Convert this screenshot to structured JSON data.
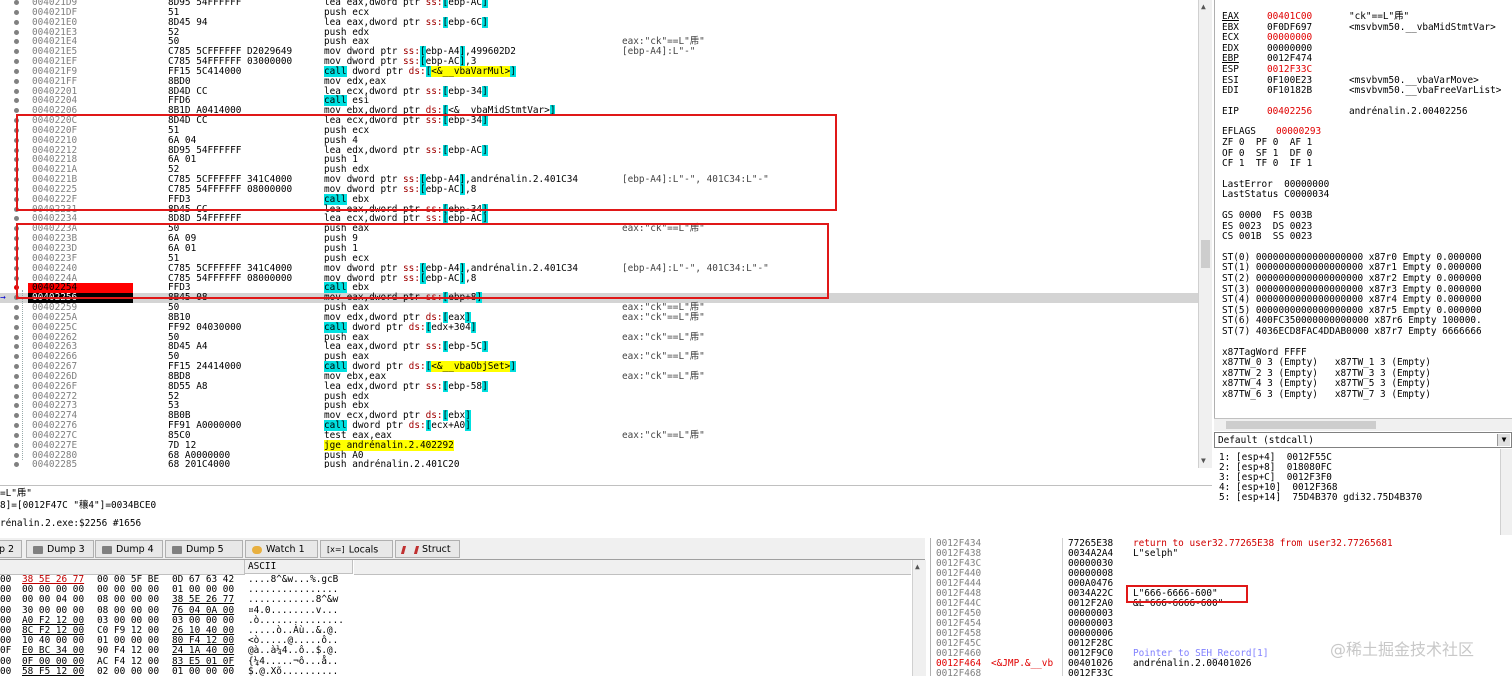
{
  "disasm": {
    "rows": [
      {
        "addr": "004021D9",
        "hex": "8D95 54FFFFFF",
        "asm": "lea eax,dword ptr ss:[ebp-AC]",
        "cmt": ""
      },
      {
        "addr": "004021DF",
        "hex": "51",
        "asm": "push ecx",
        "cmt": ""
      },
      {
        "addr": "004021E0",
        "hex": "8D45 94",
        "asm": "lea eax,dword ptr ss:[ebp-6C]",
        "cmt": ""
      },
      {
        "addr": "004021E3",
        "hex": "52",
        "asm": "push edx",
        "cmt": ""
      },
      {
        "addr": "004021E4",
        "hex": "50",
        "asm": "push eax",
        "cmt": "eax:\"ck\"==L\"乕\""
      },
      {
        "addr": "004021E5",
        "hex": "C785 5CFFFFFF D2029649",
        "asm": "mov dword ptr ss:[ebp-A4],499602D2",
        "cmt": "[ebp-A4]:L\"-\""
      },
      {
        "addr": "004021EF",
        "hex": "C785 54FFFFFF 03000000",
        "asm": "mov dword ptr ss:[ebp-AC],3",
        "cmt": ""
      },
      {
        "addr": "004021F9",
        "hex": "FF15 5C414000",
        "asm": "call dword ptr ds:[<&__vbaVarMul>]",
        "cmt": "",
        "call": true,
        "label": "<&__vbaVarMul>"
      },
      {
        "addr": "004021FF",
        "hex": "8BD0",
        "asm": "mov edx,eax",
        "cmt": ""
      },
      {
        "addr": "00402201",
        "hex": "8D4D CC",
        "asm": "lea ecx,dword ptr ss:[ebp-34]",
        "cmt": ""
      },
      {
        "addr": "00402204",
        "hex": "FFD6",
        "asm": "call esi",
        "cmt": "",
        "call": true
      },
      {
        "addr": "00402206",
        "hex": "8B1D A0414000",
        "asm": "mov ebx,dword ptr ds:[<&__vbaMidStmtVar>]",
        "cmt": ""
      },
      {
        "addr": "0040220C",
        "hex": "8D4D CC",
        "asm": "lea ecx,dword ptr ss:[ebp-34]",
        "cmt": ""
      },
      {
        "addr": "0040220F",
        "hex": "51",
        "asm": "push ecx",
        "cmt": ""
      },
      {
        "addr": "00402210",
        "hex": "6A 04",
        "asm": "push 4",
        "cmt": ""
      },
      {
        "addr": "00402212",
        "hex": "8D95 54FFFFFF",
        "asm": "lea edx,dword ptr ss:[ebp-AC]",
        "cmt": ""
      },
      {
        "addr": "00402218",
        "hex": "6A 01",
        "asm": "push 1",
        "cmt": ""
      },
      {
        "addr": "0040221A",
        "hex": "52",
        "asm": "push edx",
        "cmt": ""
      },
      {
        "addr": "0040221B",
        "hex": "C785 5CFFFFFF 341C4000",
        "asm": "mov dword ptr ss:[ebp-A4],andrénalin.2.401C34",
        "cmt": "[ebp-A4]:L\"-\", 401C34:L\"-\""
      },
      {
        "addr": "00402225",
        "hex": "C785 54FFFFFF 08000000",
        "asm": "mov dword ptr ss:[ebp-AC],8",
        "cmt": ""
      },
      {
        "addr": "0040222F",
        "hex": "FFD3",
        "asm": "call ebx",
        "cmt": "",
        "call": true
      },
      {
        "addr": "00402231",
        "hex": "8D45 CC",
        "asm": "lea eax,dword ptr ss:[ebp-34]",
        "cmt": ""
      },
      {
        "addr": "00402234",
        "hex": "8D8D 54FFFFFF",
        "asm": "lea ecx,dword ptr ss:[ebp-AC]",
        "cmt": ""
      },
      {
        "addr": "0040223A",
        "hex": "50",
        "asm": "push eax",
        "cmt": "eax:\"ck\"==L\"乕\""
      },
      {
        "addr": "0040223B",
        "hex": "6A 09",
        "asm": "push 9",
        "cmt": ""
      },
      {
        "addr": "0040223D",
        "hex": "6A 01",
        "asm": "push 1",
        "cmt": ""
      },
      {
        "addr": "0040223F",
        "hex": "51",
        "asm": "push ecx",
        "cmt": ""
      },
      {
        "addr": "00402240",
        "hex": "C785 5CFFFFFF 341C4000",
        "asm": "mov dword ptr ss:[ebp-A4],andrénalin.2.401C34",
        "cmt": "[ebp-A4]:L\"-\", 401C34:L\"-\""
      },
      {
        "addr": "0040224A",
        "hex": "C785 54FFFFFF 08000000",
        "asm": "mov dword ptr ss:[ebp-AC],8",
        "cmt": ""
      },
      {
        "addr": "00402254",
        "hex": "FFD3",
        "asm": "call ebx",
        "cmt": "",
        "call": true,
        "bp": true
      },
      {
        "addr": "00402256",
        "hex": "8B45 08",
        "asm": "mov eax,dword ptr ss:[ebp+8]",
        "cmt": "",
        "eip": true
      },
      {
        "addr": "00402259",
        "hex": "50",
        "asm": "push eax",
        "cmt": "eax:\"ck\"==L\"乕\""
      },
      {
        "addr": "0040225A",
        "hex": "8B10",
        "asm": "mov edx,dword ptr ds:[eax]",
        "cmt": "eax:\"ck\"==L\"乕\""
      },
      {
        "addr": "0040225C",
        "hex": "FF92 04030000",
        "asm": "call dword ptr ds:[edx+304]",
        "cmt": "",
        "call": true
      },
      {
        "addr": "00402262",
        "hex": "50",
        "asm": "push eax",
        "cmt": "eax:\"ck\"==L\"乕\""
      },
      {
        "addr": "00402263",
        "hex": "8D45 A4",
        "asm": "lea eax,dword ptr ss:[ebp-5C]",
        "cmt": ""
      },
      {
        "addr": "00402266",
        "hex": "50",
        "asm": "push eax",
        "cmt": "eax:\"ck\"==L\"乕\""
      },
      {
        "addr": "00402267",
        "hex": "FF15 24414000",
        "asm": "call dword ptr ds:[<&__vbaObjSet>]",
        "cmt": "",
        "call": true,
        "label": "<&__vbaObjSet>"
      },
      {
        "addr": "0040226D",
        "hex": "8BD8",
        "asm": "mov ebx,eax",
        "cmt": "eax:\"ck\"==L\"乕\""
      },
      {
        "addr": "0040226F",
        "hex": "8D55 A8",
        "asm": "lea edx,dword ptr ss:[ebp-58]",
        "cmt": ""
      },
      {
        "addr": "00402272",
        "hex": "52",
        "asm": "push edx",
        "cmt": ""
      },
      {
        "addr": "00402273",
        "hex": "53",
        "asm": "push ebx",
        "cmt": ""
      },
      {
        "addr": "00402274",
        "hex": "8B0B",
        "asm": "mov ecx,dword ptr ds:[ebx]",
        "cmt": ""
      },
      {
        "addr": "00402276",
        "hex": "FF91 A0000000",
        "asm": "call dword ptr ds:[ecx+A0]",
        "cmt": "",
        "call": true
      },
      {
        "addr": "0040227C",
        "hex": "85C0",
        "asm": "test eax,eax",
        "cmt": "eax:\"ck\"==L\"乕\""
      },
      {
        "addr": "0040227E",
        "hex": "7D 12",
        "asm": "jge andrénalin.2.402292",
        "cmt": "",
        "jmp": true
      },
      {
        "addr": "00402280",
        "hex": "68 A0000000",
        "asm": "push A0",
        "cmt": ""
      },
      {
        "addr": "00402285",
        "hex": "68 201C4000",
        "asm": "push andrénalin.2.401C20",
        "cmt": ""
      }
    ]
  },
  "registers": {
    "gp": [
      {
        "name": "EAX",
        "value": "00401C00",
        "cmt": "\"ck\"==L\"乕\"",
        "changed": true
      },
      {
        "name": "EBX",
        "value": "0F0DF697",
        "cmt": "<msvbvm50.__vbaMidStmtVar>"
      },
      {
        "name": "ECX",
        "value": "00000000",
        "cmt": "",
        "changed": true
      },
      {
        "name": "EDX",
        "value": "00000000",
        "cmt": ""
      },
      {
        "name": "EBP",
        "value": "0012F474",
        "cmt": ""
      },
      {
        "name": "ESP",
        "value": "0012F33C",
        "cmt": "",
        "changed": true
      },
      {
        "name": "ESI",
        "value": "0F100E23",
        "cmt": "<msvbvm50.__vbaVarMove>"
      },
      {
        "name": "EDI",
        "value": "0F10182B",
        "cmt": "<msvbvm50.__vbaFreeVarList>"
      }
    ],
    "eip": {
      "name": "EIP",
      "value": "00402256",
      "cmt": "andrénalin.2.00402256"
    },
    "eflags": {
      "name": "EFLAGS",
      "value": "00000293"
    },
    "flags": [
      "ZF 0  PF 0  AF 1",
      "OF 0  SF 1  DF 0",
      "CF 1  TF 0  IF 1"
    ],
    "last": [
      "LastError  00000000",
      "LastStatus C0000034"
    ],
    "segs": [
      "GS 0000  FS 003B",
      "ES 0023  DS 0023",
      "CS 001B  SS 0023"
    ],
    "st": [
      "ST(0) 0000000000000000000 x87r0 Empty 0.000000",
      "ST(1) 0000000000000000000 x87r1 Empty 0.000000",
      "ST(2) 0000000000000000000 x87r2 Empty 0.000000",
      "ST(3) 0000000000000000000 x87r3 Empty 0.000000",
      "ST(4) 0000000000000000000 x87r4 Empty 0.000000",
      "ST(5) 0000000000000000000 x87r5 Empty 0.000000",
      "ST(6) 400FC350000000000000 x87r6 Empty 100000.",
      "ST(7) 4036ECD8FAC4DDAB0000 x87r7 Empty 6666666"
    ],
    "tag": [
      "x87TagWord FFFF",
      "x87TW_0 3 (Empty)   x87TW_1 3 (Empty)",
      "x87TW_2 3 (Empty)   x87TW_3 3 (Empty)",
      "x87TW_4 3 (Empty)   x87TW_5 3 (Empty)",
      "x87TW_6 3 (Empty)   x87TW_7 3 (Empty)"
    ]
  },
  "callconv": {
    "value": "Default (stdcall)"
  },
  "stackargs": [
    "1: [esp+4]  0012F55C",
    "2: [esp+8]  018080FC",
    "3: [esp+C]  0012F3F0",
    "4: [esp+10]  0012F368",
    "5: [esp+14]  75D4B370 gdi32.75D4B370"
  ],
  "info": {
    "line1": "=L\"乕\"",
    "line2": "8]=[0012F47C \"穰4\"]=0034BCE0",
    "line3": "rénalin.2.exe:$2256 #1656"
  },
  "tabs": [
    {
      "label": "p 2"
    },
    {
      "label": "Dump 3"
    },
    {
      "label": "Dump 4"
    },
    {
      "label": "Dump 5"
    },
    {
      "label": "Watch 1"
    },
    {
      "label": "Locals",
      "prefix": "[x=]"
    },
    {
      "label": "Struct"
    }
  ],
  "dump": {
    "ascii_header": "ASCII",
    "rows": [
      {
        "a": "00",
        "b": "38 5E 26 77",
        "c": "00 00 5F BE",
        "d": "0D 67 63 42",
        "asc": "....8^&w...%.gcB"
      },
      {
        "a": "00",
        "b": "00 00 00 00",
        "c": "00 00 00 00",
        "d": "01 00 00 00",
        "asc": "................"
      },
      {
        "a": "00",
        "b": "00 00 04 00",
        "c": "08 00 00 00",
        "d": "38 5E 26 77",
        "asc": "............8^&w"
      },
      {
        "a": "00",
        "b": "30 00 00 00",
        "c": "08 00 00 00",
        "d": "76 04 0A 00",
        "asc": "¤4.0........v..."
      },
      {
        "a": "00",
        "b": "A0 F2 12 00",
        "c": "03 00 00 00",
        "d": "03 00 00 00",
        "asc": ".ò..............."
      },
      {
        "a": "00",
        "b": "8C F2 12 00",
        "c": "C0 F9 12 00",
        "d": "26 10 40 00",
        "asc": ".....ò..Àù..&.@."
      },
      {
        "a": "00",
        "b": "10 40 00 00",
        "c": "01 00 00 00",
        "d": "80 F4 12 00",
        "asc": "<ò.....@.....ô.."
      },
      {
        "a": "0F",
        "b": "E0 BC 34 00",
        "c": "90 F4 12 00",
        "d": "24 1A 40 00",
        "asc": "@à..à¼4..ô..$.@."
      },
      {
        "a": "00",
        "b": "0F 00 00 00",
        "c": "AC F4 12 00",
        "d": "83 E5 01 0F",
        "asc": "{¼4.....¬ô...å.."
      },
      {
        "a": "00",
        "b": "58 F5 12 00",
        "c": "02 00 00 00",
        "d": "01 00 00 00",
        "asc": "$.@.Xõ.........."
      }
    ]
  },
  "stack": {
    "rows": [
      {
        "addr": "0012F434",
        "val": "77265E38",
        "cmt": "return to user32.77265E38 from user32.77265681",
        "red": true
      },
      {
        "addr": "0012F438",
        "val": "0034A2A4",
        "cmt": "L\"selph\""
      },
      {
        "addr": "0012F43C",
        "val": "00000030",
        "cmt": ""
      },
      {
        "addr": "0012F440",
        "val": "00000008",
        "cmt": ""
      },
      {
        "addr": "0012F444",
        "val": "000A0476",
        "cmt": ""
      },
      {
        "addr": "0012F448",
        "val": "0034A22C",
        "cmt": "L\"666-6666-600\""
      },
      {
        "addr": "0012F44C",
        "val": "0012F2A0",
        "cmt": "&L\"666-6666-600\""
      },
      {
        "addr": "0012F450",
        "val": "00000003",
        "cmt": ""
      },
      {
        "addr": "0012F454",
        "val": "00000003",
        "cmt": ""
      },
      {
        "addr": "0012F458",
        "val": "00000006",
        "cmt": ""
      },
      {
        "addr": "0012F45C",
        "val": "0012F28C",
        "cmt": ""
      },
      {
        "addr": "0012F460",
        "val": "0012F9C0",
        "cmt": "Pointer to SEH_Record[1]",
        "blue": true
      },
      {
        "addr": "0012F464",
        "val": "00401026",
        "cmt": "andrénalin.2.00401026",
        "tag": "<&JMP.&__vb"
      },
      {
        "addr": "0012F468",
        "val": "0012F33C",
        "cmt": ""
      }
    ]
  },
  "watermark": "@稀土掘金技术社区"
}
